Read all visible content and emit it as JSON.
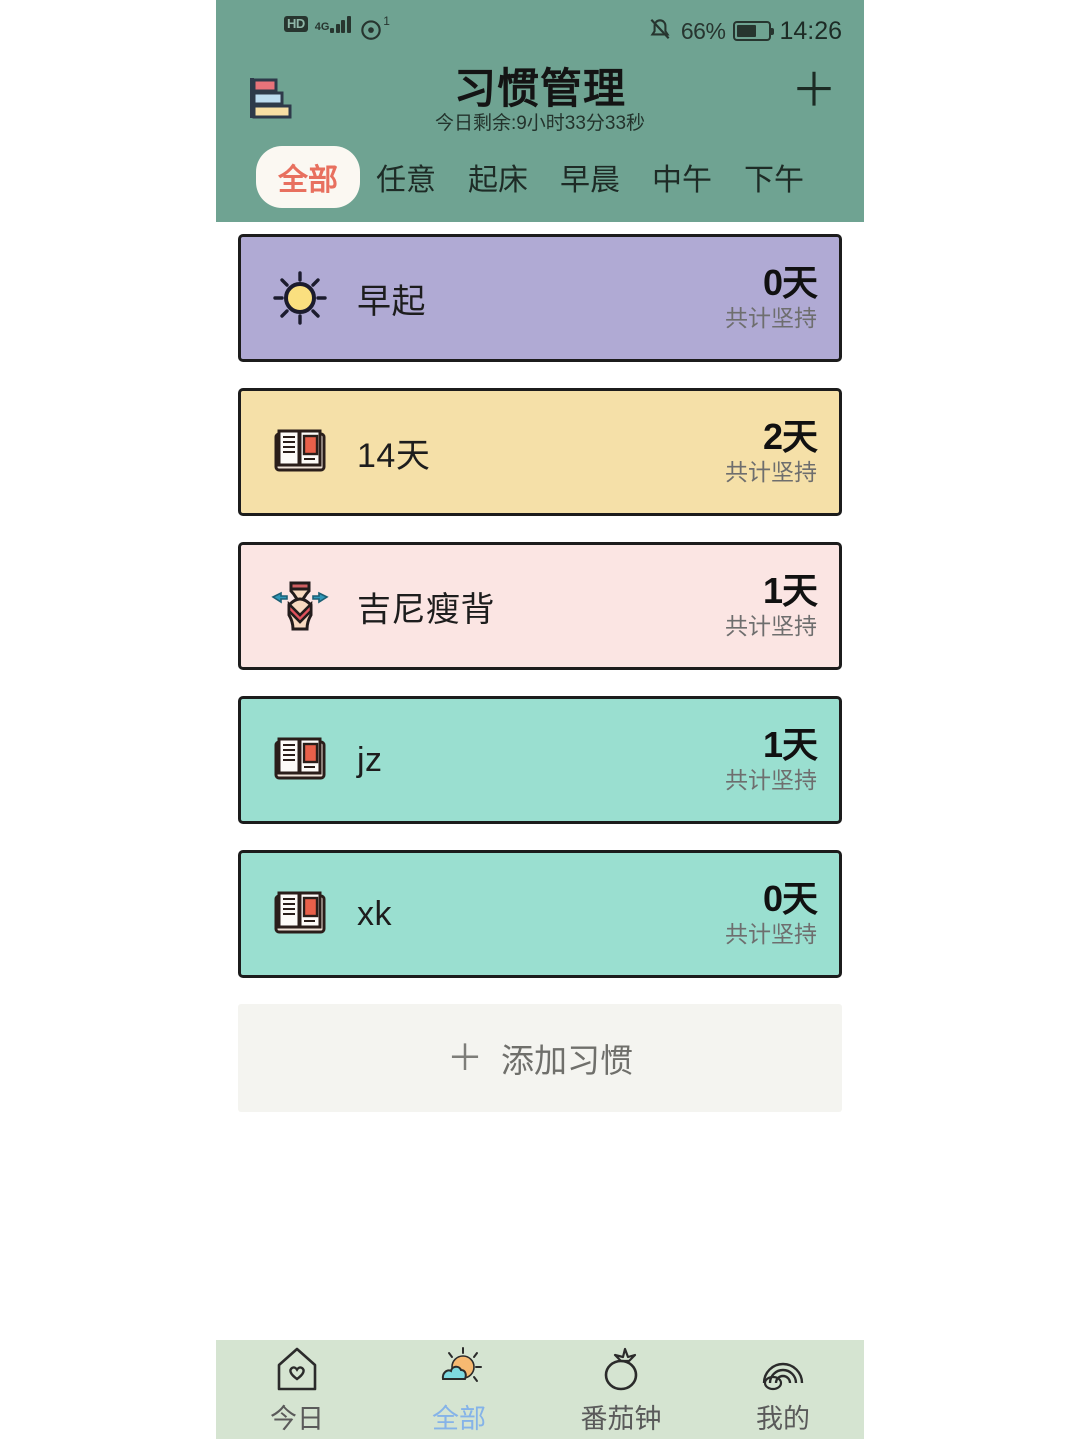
{
  "status_bar": {
    "hd_label": "HD",
    "network_label": "4G",
    "hotspot_badge": "1",
    "battery_percent": "66%",
    "time": "14:26",
    "icons": [
      "hd-icon",
      "signal-icon",
      "hotspot-icon",
      "mute-icon",
      "battery-icon"
    ]
  },
  "header": {
    "logo_icon": "bar-chart-logo-icon",
    "title": "习惯管理",
    "subtitle": "今日剩余:9小时33分33秒",
    "add_icon": "plus-icon",
    "background_color": "#6fa392"
  },
  "tabs": [
    {
      "label": "全部",
      "active": true
    },
    {
      "label": "任意",
      "active": false
    },
    {
      "label": "起床",
      "active": false
    },
    {
      "label": "早晨",
      "active": false
    },
    {
      "label": "中午",
      "active": false
    },
    {
      "label": "下午",
      "active": false
    }
  ],
  "tab_active_text_color": "#e8705f",
  "habits": [
    {
      "icon": "sun-icon",
      "name": "早起",
      "days": "0天",
      "days_label": "共计坚持",
      "color": "#b0aad4"
    },
    {
      "icon": "book-icon",
      "name": "14天",
      "days": "2天",
      "days_label": "共计坚持",
      "color": "#f5e0a8"
    },
    {
      "icon": "waist-icon",
      "name": "吉尼瘦背",
      "days": "1天",
      "days_label": "共计坚持",
      "color": "#fbe5e3"
    },
    {
      "icon": "book-icon",
      "name": "jz",
      "days": "1天",
      "days_label": "共计坚持",
      "color": "#9adfd0"
    },
    {
      "icon": "book-icon",
      "name": "xk",
      "days": "0天",
      "days_label": "共计坚持",
      "color": "#9adfd0"
    }
  ],
  "add_habit": {
    "plus": "＋",
    "label": "添加习惯"
  },
  "bottom_nav": [
    {
      "label": "今日",
      "icon": "house-heart-icon",
      "active": false
    },
    {
      "label": "全部",
      "icon": "sun-cloud-icon",
      "active": true
    },
    {
      "label": "番茄钟",
      "icon": "tomato-icon",
      "active": false
    },
    {
      "label": "我的",
      "icon": "rainbow-icon",
      "active": false
    }
  ],
  "bottom_nav_active_color": "#85b3e8"
}
